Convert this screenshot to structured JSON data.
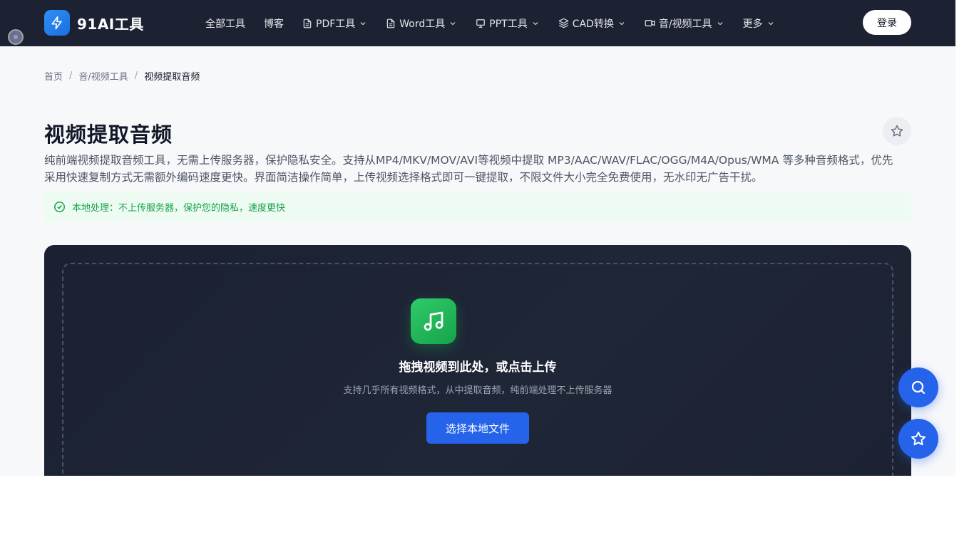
{
  "header": {
    "logo_text": "91AI工具",
    "nav": [
      {
        "label": "全部工具",
        "icon": "none"
      },
      {
        "label": "博客",
        "icon": "none"
      },
      {
        "label": "PDF工具",
        "icon": "document-icon"
      },
      {
        "label": "Word工具",
        "icon": "document-icon"
      },
      {
        "label": "PPT工具",
        "icon": "presentation-icon"
      },
      {
        "label": "CAD转换",
        "icon": "layers-icon"
      },
      {
        "label": "音/视频工具",
        "icon": "video-icon"
      },
      {
        "label": "更多",
        "icon": "none"
      }
    ],
    "login_label": "登录"
  },
  "breadcrumb": {
    "home": "首页",
    "category": "音/视频工具",
    "current": "视频提取音频"
  },
  "page": {
    "title": "视频提取音频",
    "description": "纯前端视频提取音频工具，无需上传服务器，保护隐私安全。支持从MP4/MKV/MOV/AVI等视频中提取 MP3/AAC/WAV/FLAC/OGG/M4A/Opus/WMA 等多种音频格式，优先采用快速复制方式无需额外编码速度更快。界面简洁操作简单，上传视频选择格式即可一键提取，不限文件大小完全免费使用，无水印无广告干扰。",
    "notice": "本地处理：不上传服务器，保护您的隐私，速度更快"
  },
  "upload": {
    "title": "拖拽视频到此处，或点击上传",
    "subtitle": "支持几乎所有视频格式，从中提取音频，纯前端处理不上传服务器",
    "button_label": "选择本地文件"
  },
  "colors": {
    "header_bg": "#1d2233",
    "accent": "#2563eb",
    "success": "#16a34a",
    "panel_bg": "#1f2637"
  }
}
